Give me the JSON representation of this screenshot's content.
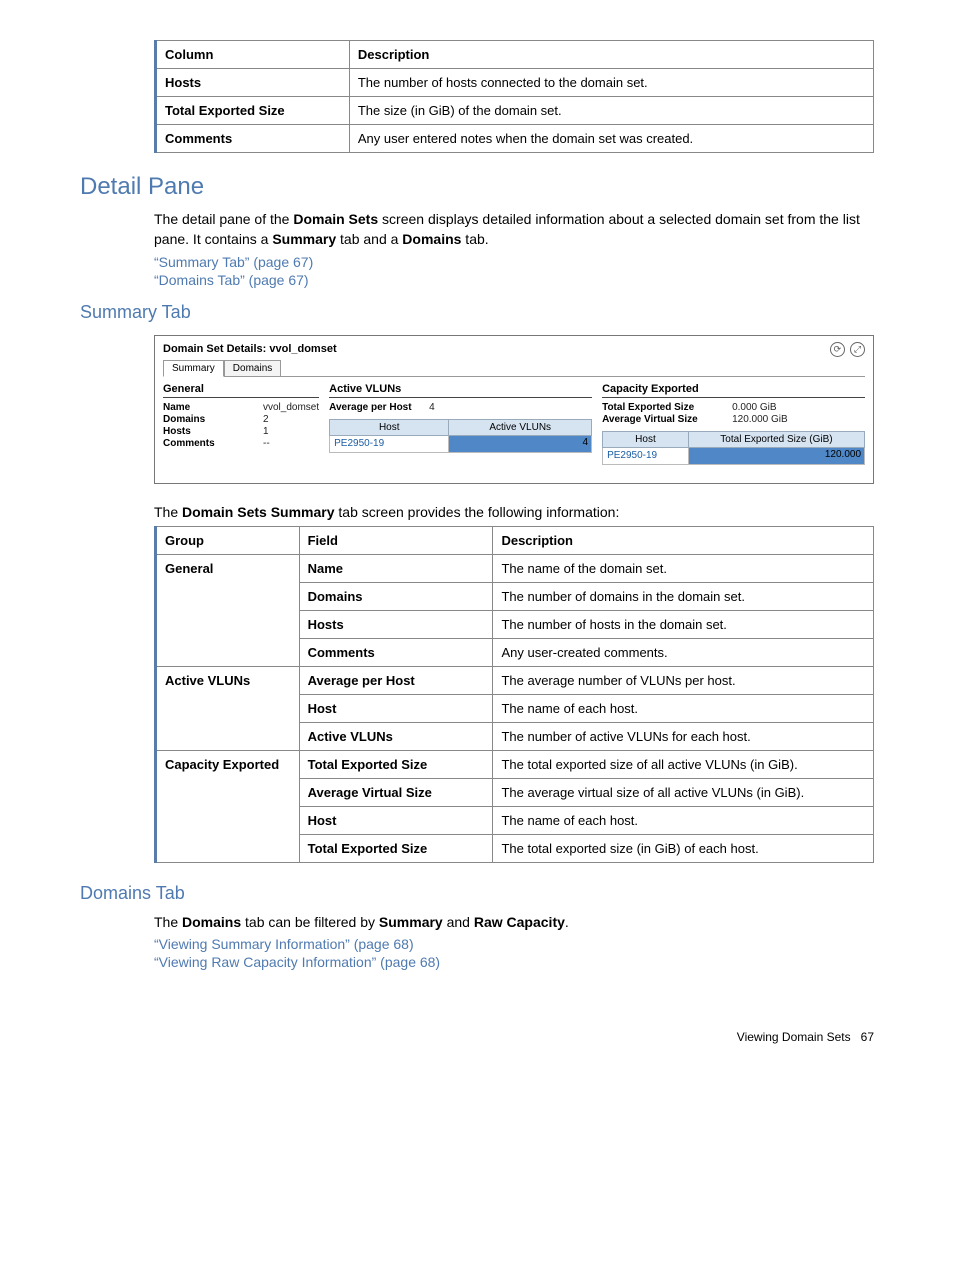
{
  "table1": {
    "headers": [
      "Column",
      "Description"
    ],
    "rows": [
      [
        "Hosts",
        "The number of hosts connected to the domain set."
      ],
      [
        "Total Exported Size",
        "The size (in GiB) of the domain set."
      ],
      [
        "Comments",
        "Any user entered notes when the domain set was created."
      ]
    ]
  },
  "section_detail_pane": {
    "heading": "Detail Pane",
    "para_segments": [
      "The detail pane of the ",
      "Domain Sets",
      " screen displays detailed information about a selected domain set from the list pane. It contains a ",
      "Summary",
      " tab and a ",
      "Domains",
      " tab."
    ],
    "links": [
      "“Summary Tab” (page 67)",
      "“Domains Tab” (page 67)"
    ]
  },
  "summary_tab": {
    "heading": "Summary Tab",
    "screenshot": {
      "title": "Domain Set Details: vvol_domset",
      "tabs": [
        "Summary",
        "Domains"
      ],
      "active_tab": 0,
      "general": {
        "header": "General",
        "rows": [
          [
            "Name",
            "vvol_domset"
          ],
          [
            "Domains",
            "2"
          ],
          [
            "Hosts",
            "1"
          ],
          [
            "Comments",
            "--"
          ]
        ]
      },
      "active_vluns": {
        "header": "Active VLUNs",
        "avg_label": "Average per Host",
        "avg_value": "4",
        "table_headers": [
          "Host",
          "Active VLUNs"
        ],
        "row_host": "PE2950-19",
        "row_value": "4"
      },
      "capacity": {
        "header": "Capacity Exported",
        "kv": [
          [
            "Total Exported Size",
            "0.000 GiB"
          ],
          [
            "Average Virtual Size",
            "120.000 GiB"
          ]
        ],
        "table_headers": [
          "Host",
          "Total Exported Size (GiB)"
        ],
        "row_host": "PE2950-19",
        "row_value": "120.000"
      }
    },
    "intro_segments": [
      "The ",
      "Domain Sets Summary",
      " tab screen provides the following information:"
    ],
    "table": {
      "headers": [
        "Group",
        "Field",
        "Description"
      ],
      "groups": [
        {
          "group": "General",
          "rows": [
            [
              "Name",
              "The name of the domain set."
            ],
            [
              "Domains",
              "The number of domains in the domain set."
            ],
            [
              "Hosts",
              "The number of hosts in the domain set."
            ],
            [
              "Comments",
              "Any user-created comments."
            ]
          ]
        },
        {
          "group": "Active VLUNs",
          "rows": [
            [
              "Average per Host",
              "The average number of VLUNs per host."
            ],
            [
              "Host",
              "The name of each host."
            ],
            [
              "Active VLUNs",
              "The number of active VLUNs for each host."
            ]
          ]
        },
        {
          "group": "Capacity Exported",
          "rows": [
            [
              "Total Exported Size",
              "The total exported size of all active VLUNs (in GiB)."
            ],
            [
              "Average Virtual Size",
              "The average virtual size of all active VLUNs (in GiB)."
            ],
            [
              "Host",
              "The name of each host."
            ],
            [
              "Total Exported Size",
              "The total exported size (in GiB) of each host."
            ]
          ]
        }
      ]
    }
  },
  "domains_tab": {
    "heading": "Domains Tab",
    "para_segments": [
      "The ",
      "Domains",
      " tab can be filtered by ",
      "Summary",
      " and ",
      "Raw Capacity",
      "."
    ],
    "links": [
      "“Viewing Summary Information” (page 68)",
      "“Viewing Raw Capacity Information” (page 68)"
    ]
  },
  "footer": {
    "text": "Viewing Domain Sets",
    "page": "67"
  }
}
